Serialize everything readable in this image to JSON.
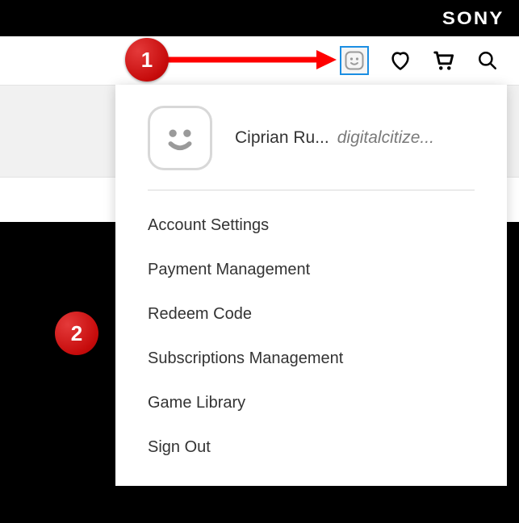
{
  "brand": "SONY",
  "user": {
    "display_name": "Ciprian Ru...",
    "handle": "digitalcitize..."
  },
  "menu": {
    "items": [
      "Account Settings",
      "Payment Management",
      "Redeem Code",
      "Subscriptions Management",
      "Game Library",
      "Sign Out"
    ]
  },
  "callouts": {
    "one": "1",
    "two": "2"
  },
  "colors": {
    "highlight": "#1b8ee3",
    "callout": "#c60b0b"
  }
}
